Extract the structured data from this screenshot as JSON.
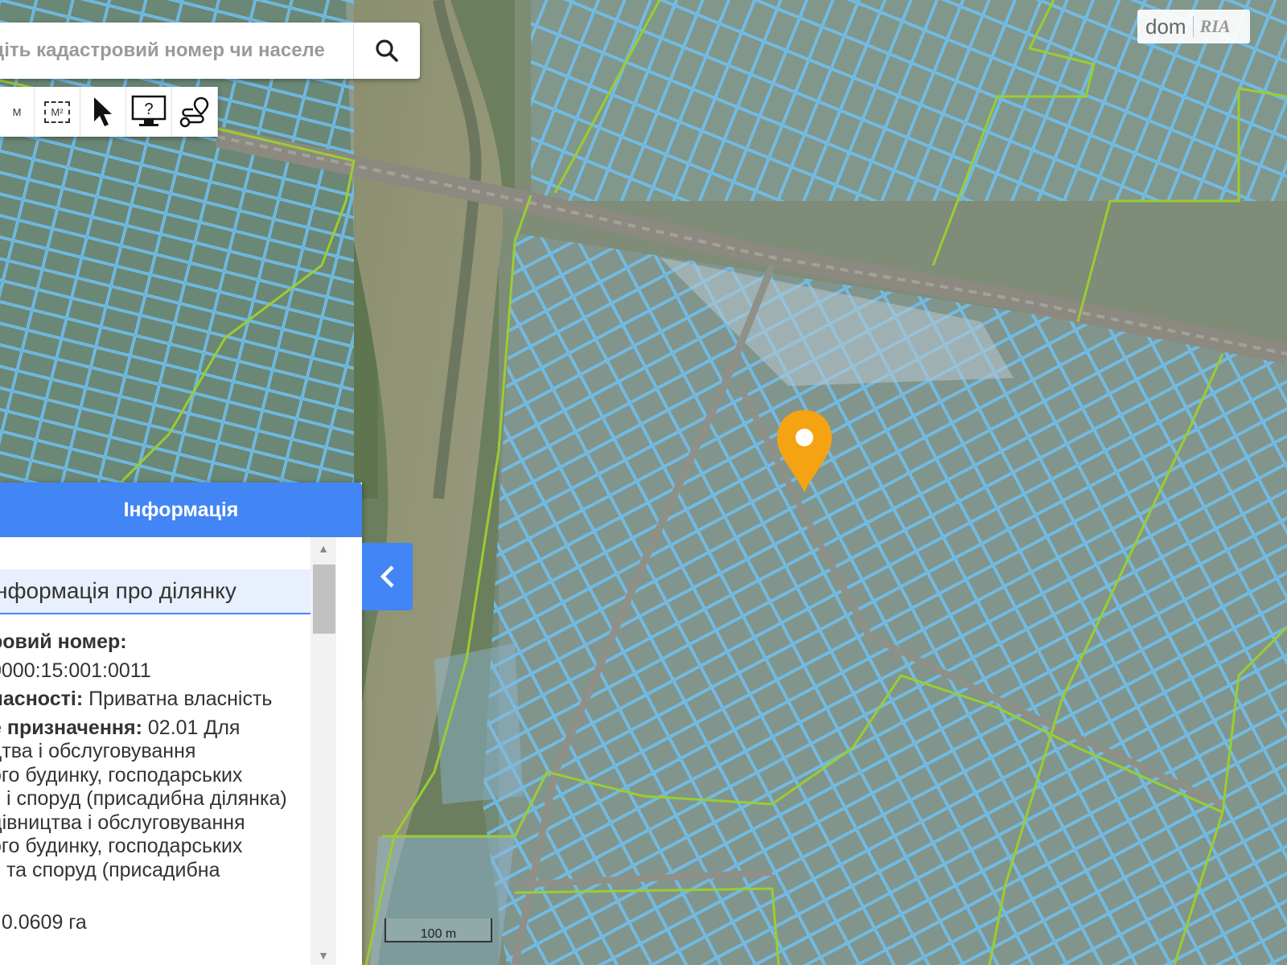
{
  "search": {
    "placeholder": "діть кадастровий номер чи населе"
  },
  "toolbar": {
    "items": [
      {
        "name": "measure-length",
        "label": "М"
      },
      {
        "name": "measure-area",
        "label": "М²"
      },
      {
        "name": "select",
        "label": ""
      },
      {
        "name": "info",
        "label": "?"
      },
      {
        "name": "route",
        "label": ""
      }
    ]
  },
  "logo": {
    "dom": "dom",
    "ria": "RIA"
  },
  "panel": {
    "header": "Інформація",
    "section_title": "нформація про ділянку",
    "cadastral_label": "ровий номер:",
    "cadastral_value": "0000:15:001:0011",
    "ownership_label": "ласності:",
    "ownership_value": " Приватна власність",
    "purpose_label": "е призначення:",
    "purpose_lines": [
      " 02.01 Для",
      "цтва і обслуговування",
      "ого будинку, господарських",
      "ь і споруд (присадибна ділянка)",
      "дівництва і обслуговування",
      "ого будинку, господарських",
      "ь та споруд (присадибна",
      ")"
    ],
    "area_line": ": 0.0609 га"
  },
  "map": {
    "scale_label": "100 m",
    "marker_color": "#f5a312",
    "parcel_color": "#6ec3f7",
    "boundary_color": "#9acd32"
  }
}
